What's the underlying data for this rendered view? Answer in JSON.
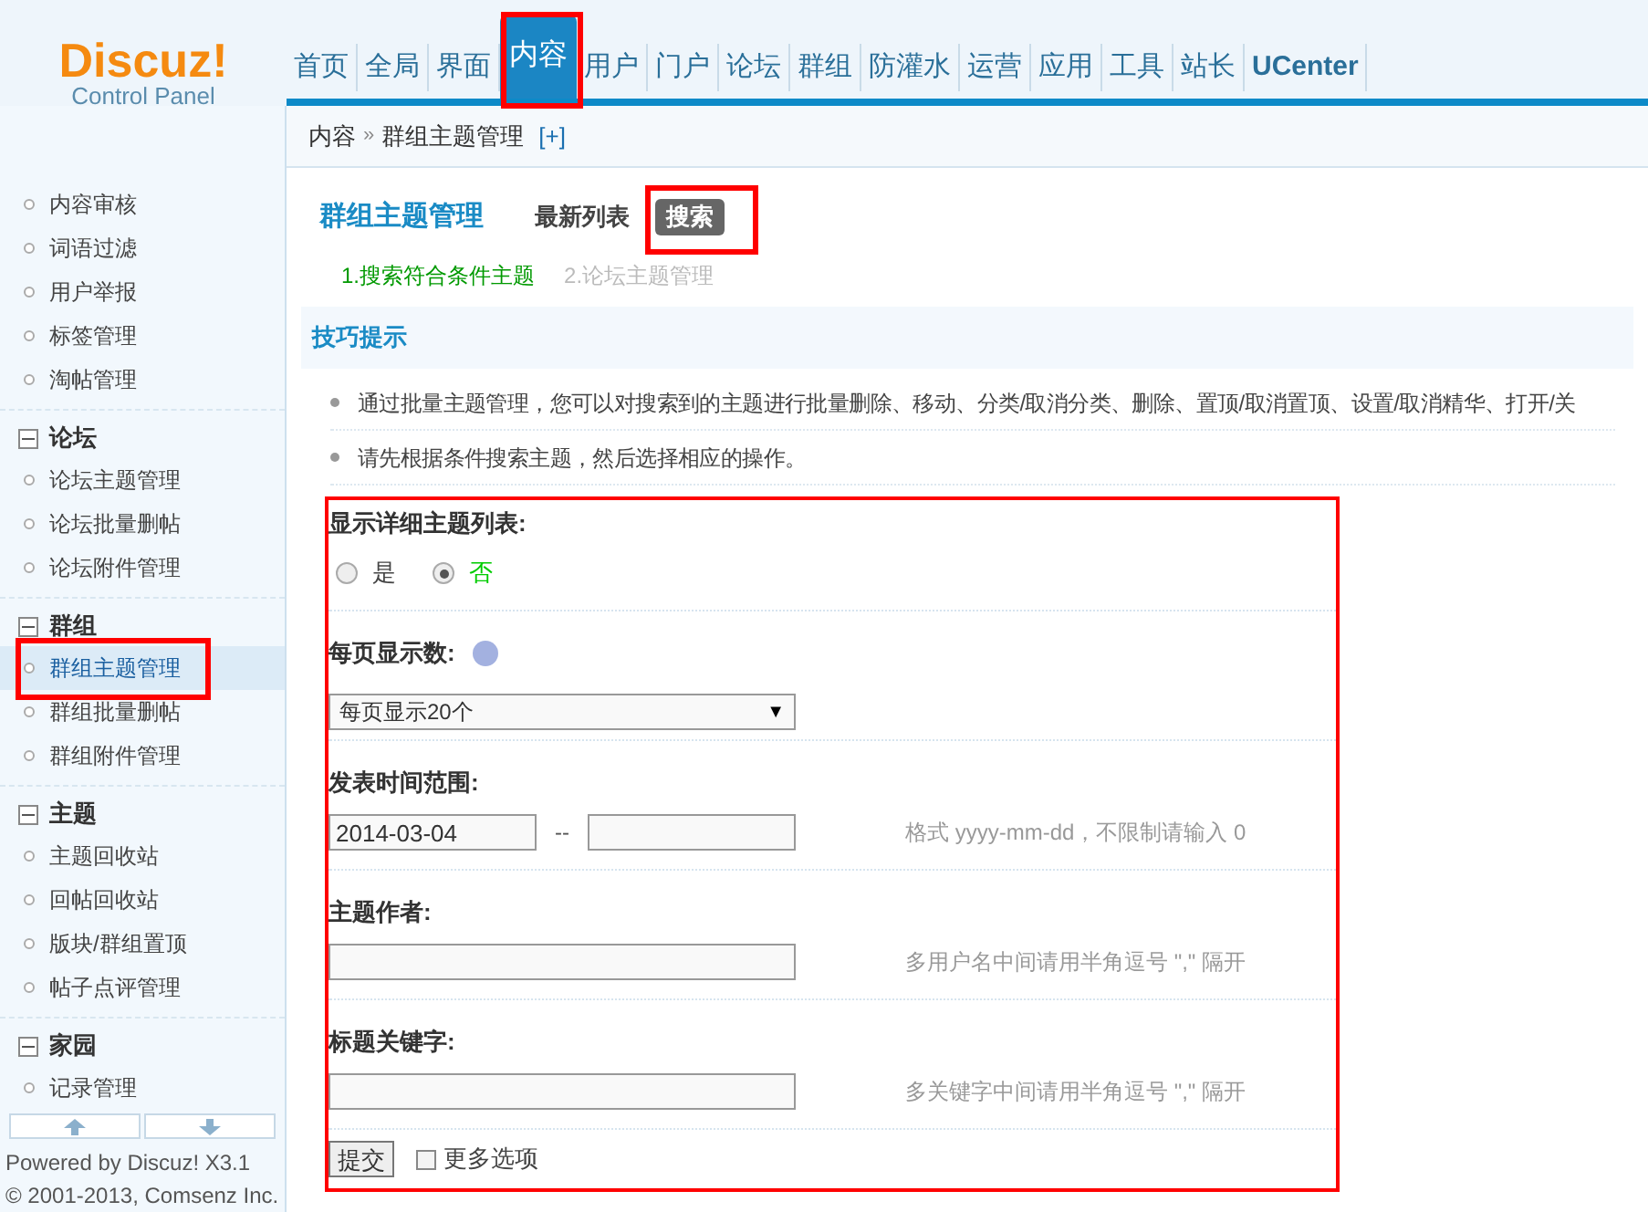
{
  "logo": {
    "title": "Discuz!",
    "subtitle": "Control Panel"
  },
  "nav": [
    {
      "label": "首页",
      "selected": false
    },
    {
      "label": "全局",
      "selected": false
    },
    {
      "label": "界面",
      "selected": false
    },
    {
      "label": "内容",
      "selected": true
    },
    {
      "label": "用户",
      "selected": false
    },
    {
      "label": "门户",
      "selected": false
    },
    {
      "label": "论坛",
      "selected": false
    },
    {
      "label": "群组",
      "selected": false
    },
    {
      "label": "防灌水",
      "selected": false
    },
    {
      "label": "运营",
      "selected": false
    },
    {
      "label": "应用",
      "selected": false
    },
    {
      "label": "工具",
      "selected": false
    },
    {
      "label": "站长",
      "selected": false
    },
    {
      "label": "UCenter",
      "selected": false
    }
  ],
  "breadcrumb": {
    "parent": "内容",
    "separator": "»",
    "current": "群组主题管理",
    "add": "[+]"
  },
  "sidebar": {
    "groups": [
      {
        "items": [
          {
            "label": "内容审核",
            "selected": false
          },
          {
            "label": "词语过滤",
            "selected": false
          },
          {
            "label": "用户举报",
            "selected": false
          },
          {
            "label": "标签管理",
            "selected": false
          },
          {
            "label": "淘帖管理",
            "selected": false
          }
        ]
      },
      {
        "title": "论坛",
        "expanded": true,
        "items": [
          {
            "label": "论坛主题管理",
            "selected": false
          },
          {
            "label": "论坛批量删帖",
            "selected": false
          },
          {
            "label": "论坛附件管理",
            "selected": false
          }
        ]
      },
      {
        "title": "群组",
        "expanded": true,
        "items": [
          {
            "label": "群组主题管理",
            "selected": true
          },
          {
            "label": "群组批量删帖",
            "selected": false
          },
          {
            "label": "群组附件管理",
            "selected": false
          }
        ]
      },
      {
        "title": "主题",
        "expanded": true,
        "items": [
          {
            "label": "主题回收站",
            "selected": false
          },
          {
            "label": "回帖回收站",
            "selected": false
          },
          {
            "label": "版块/群组置顶",
            "selected": false
          },
          {
            "label": "帖子点评管理",
            "selected": false
          }
        ]
      },
      {
        "title": "家园",
        "expanded": true,
        "items": [
          {
            "label": "记录管理",
            "selected": false
          }
        ]
      }
    ],
    "footer": [
      "Powered by Discuz! X3.1",
      "© 2001-2013, Comsenz Inc."
    ]
  },
  "page": {
    "title": "群组主题管理",
    "tabs": [
      {
        "label": "最新列表",
        "selected": false
      },
      {
        "label": "搜索",
        "selected": true
      }
    ],
    "steps": [
      {
        "label": "1.搜索符合条件主题",
        "selected": true
      },
      {
        "label": "2.论坛主题管理",
        "selected": false
      }
    ],
    "tips": {
      "title": "技巧提示",
      "items": [
        "通过批量主题管理，您可以对搜索到的主题进行批量删除、移动、分类/取消分类、删除、置顶/取消置顶、设置/取消精华、打开/关",
        "请先根据条件搜索主题，然后选择相应的操作。"
      ]
    }
  },
  "form": {
    "rows": [
      {
        "kind": "radio",
        "label": "显示详细主题列表:",
        "options": [
          {
            "label": "是",
            "selected": false
          },
          {
            "label": "否",
            "selected": true
          }
        ]
      },
      {
        "kind": "select",
        "label": "每页显示数:",
        "help": true,
        "value": "每页显示20个",
        "arrow": "▼"
      },
      {
        "kind": "range",
        "label": "发表时间范围:",
        "from": "2014-03-04",
        "separator": "--",
        "hint": "格式 yyyy-mm-dd，不限制请输入 0"
      },
      {
        "kind": "text",
        "label": "主题作者:",
        "hint": "多用户名中间请用半角逗号 \",\" 隔开"
      },
      {
        "kind": "text",
        "label": "标题关键字:",
        "hint": "多关键字中间请用半角逗号 \",\" 隔开"
      }
    ],
    "submit": "提交",
    "more_options": {
      "label": "更多选项",
      "checked": false
    }
  }
}
